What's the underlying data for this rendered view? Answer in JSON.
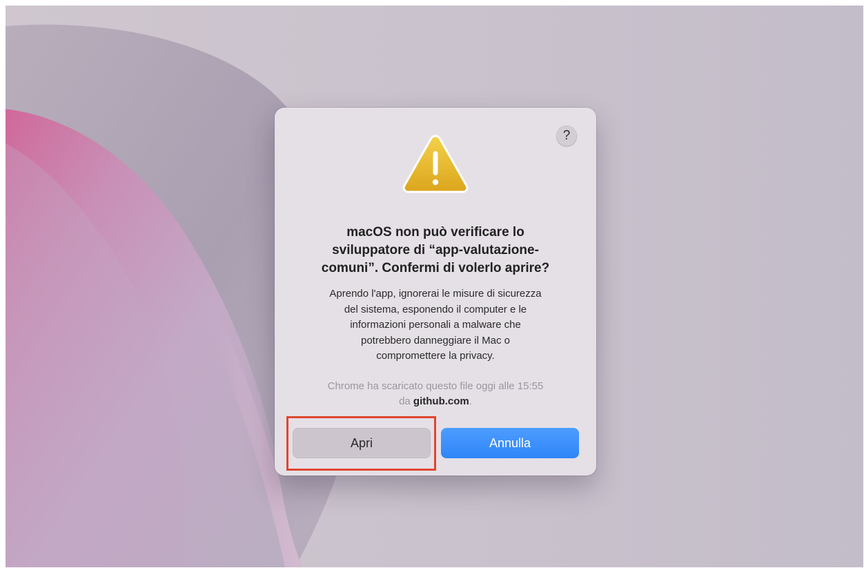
{
  "dialog": {
    "help_label": "?",
    "icon": "warning-icon",
    "title_lines": [
      "macOS non può verificare lo",
      "sviluppatore di “app-valutazione-",
      "comuni”. Confermi di volerlo aprire?"
    ],
    "body_lines": [
      "Aprendo l'app, ignorerai le misure di sicurezza",
      "del sistema, esponendo il computer e le",
      "informazioni personali a malware che",
      "potrebbero danneggiare il Mac o",
      "compromettere la privacy."
    ],
    "source_line1": "Chrome ha scaricato questo file oggi alle 15:55",
    "source_prefix": "da ",
    "source_domain": "github.com",
    "source_suffix": ".",
    "buttons": {
      "open_label": "Apri",
      "cancel_label": "Annulla"
    }
  },
  "colors": {
    "accent_blue": "#2f86f8",
    "warning_yellow": "#e7b626",
    "highlight_red": "#e0462f"
  }
}
